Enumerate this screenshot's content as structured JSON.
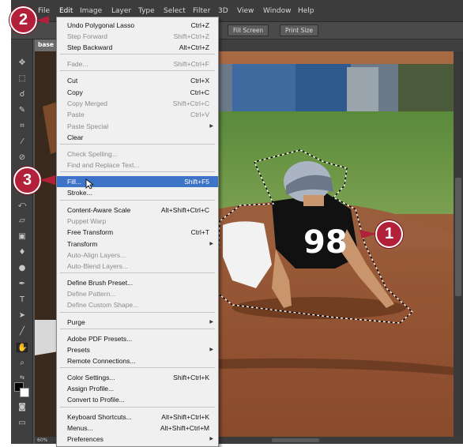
{
  "menubar": {
    "items": [
      "File",
      "Edit",
      "Image",
      "Layer",
      "Type",
      "Select",
      "Filter",
      "3D",
      "View",
      "Window",
      "Help"
    ],
    "active": "Edit"
  },
  "options_bar": {
    "fill_screen": "Fill Screen",
    "print_size": "Print Size"
  },
  "doc_tab": "base",
  "status": {
    "zoom": "60%"
  },
  "edit_menu": [
    {
      "label": "Undo Polygonal Lasso",
      "shortcut": "Ctrl+Z",
      "enabled": true
    },
    {
      "label": "Step Forward",
      "shortcut": "Shift+Ctrl+Z",
      "enabled": false
    },
    {
      "label": "Step Backward",
      "shortcut": "Alt+Ctrl+Z",
      "enabled": true
    },
    {
      "label": "Fade...",
      "shortcut": "Shift+Ctrl+F",
      "enabled": false
    },
    {
      "label": "Cut",
      "shortcut": "Ctrl+X",
      "enabled": true
    },
    {
      "label": "Copy",
      "shortcut": "Ctrl+C",
      "enabled": true
    },
    {
      "label": "Copy Merged",
      "shortcut": "Shift+Ctrl+C",
      "enabled": false
    },
    {
      "label": "Paste",
      "shortcut": "Ctrl+V",
      "enabled": false
    },
    {
      "label": "Paste Special",
      "shortcut": "",
      "enabled": false,
      "submenu": true
    },
    {
      "label": "Clear",
      "shortcut": "",
      "enabled": true
    },
    {
      "label": "Check Spelling...",
      "shortcut": "",
      "enabled": false
    },
    {
      "label": "Find and Replace Text...",
      "shortcut": "",
      "enabled": false
    },
    {
      "label": "Fill...",
      "shortcut": "Shift+F5",
      "enabled": true,
      "highlighted": true
    },
    {
      "label": "Stroke...",
      "shortcut": "",
      "enabled": true
    },
    {
      "label": "Content-Aware Scale",
      "shortcut": "Alt+Shift+Ctrl+C",
      "enabled": true
    },
    {
      "label": "Puppet Warp",
      "shortcut": "",
      "enabled": false
    },
    {
      "label": "Free Transform",
      "shortcut": "Ctrl+T",
      "enabled": true
    },
    {
      "label": "Transform",
      "shortcut": "",
      "enabled": true,
      "submenu": true
    },
    {
      "label": "Auto-Align Layers...",
      "shortcut": "",
      "enabled": false
    },
    {
      "label": "Auto-Blend Layers...",
      "shortcut": "",
      "enabled": false
    },
    {
      "label": "Define Brush Preset...",
      "shortcut": "",
      "enabled": true
    },
    {
      "label": "Define Pattern...",
      "shortcut": "",
      "enabled": false
    },
    {
      "label": "Define Custom Shape...",
      "shortcut": "",
      "enabled": false
    },
    {
      "label": "Purge",
      "shortcut": "",
      "enabled": true,
      "submenu": true
    },
    {
      "label": "Adobe PDF Presets...",
      "shortcut": "",
      "enabled": true
    },
    {
      "label": "Presets",
      "shortcut": "",
      "enabled": true,
      "submenu": true
    },
    {
      "label": "Remote Connections...",
      "shortcut": "",
      "enabled": true
    },
    {
      "label": "Color Settings...",
      "shortcut": "Shift+Ctrl+K",
      "enabled": true
    },
    {
      "label": "Assign Profile...",
      "shortcut": "",
      "enabled": true
    },
    {
      "label": "Convert to Profile...",
      "shortcut": "",
      "enabled": true
    },
    {
      "label": "Keyboard Shortcuts...",
      "shortcut": "Alt+Shift+Ctrl+K",
      "enabled": true
    },
    {
      "label": "Menus...",
      "shortcut": "Alt+Shift+Ctrl+M",
      "enabled": true
    },
    {
      "label": "Preferences",
      "shortcut": "",
      "enabled": true,
      "submenu": true
    }
  ],
  "callouts": {
    "one": "1",
    "two": "2",
    "three": "3"
  },
  "jersey_number": "98",
  "colors": {
    "highlight": "#3e74c8",
    "callout": "#b3203a"
  }
}
